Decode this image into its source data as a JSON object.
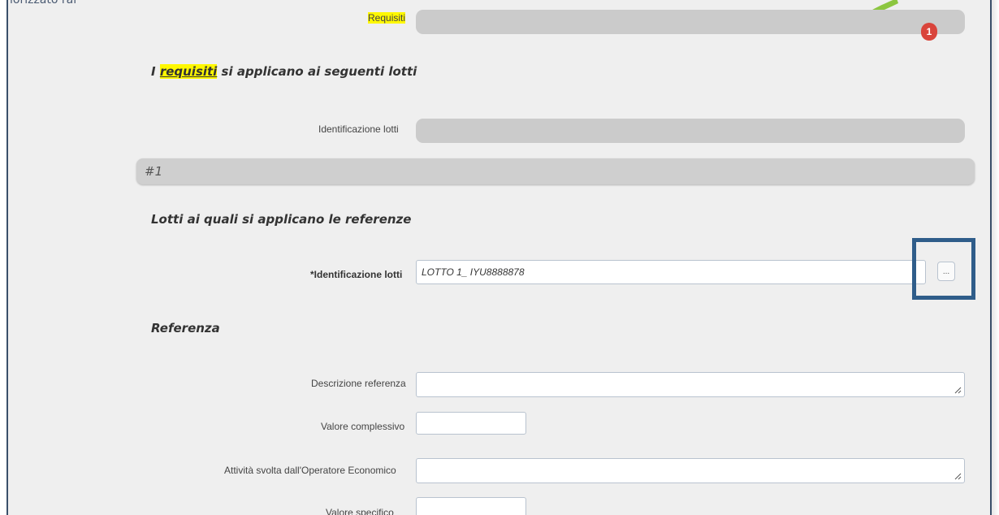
{
  "header": {
    "partial_text": "lorizzato rai",
    "requisiti_label": "Requisiti",
    "badge_count": "1"
  },
  "lotti_section": {
    "title_prefix": "I ",
    "title_highlight": "requisiti",
    "title_suffix": " si applicano ai seguenti lotti",
    "identificazione_label": "Identificazione lotti"
  },
  "group_bar": {
    "label": "#1"
  },
  "referenze_section": {
    "title": "Lotti ai quali si applicano le referenze",
    "identificazione_label": "*Identificazione lotti",
    "identificazione_value": "LOTTO 1_ IYU8888878",
    "browse_button": "..."
  },
  "referenza": {
    "title": "Referenza",
    "descrizione_label": "Descrizione referenza",
    "descrizione_value": "",
    "valore_complessivo_label": "Valore complessivo",
    "valore_complessivo_value": "",
    "attivita_label": "Attività svolta dall'Operatore Economico",
    "attivita_value": "",
    "valore_specifico_label": "Valore specifico",
    "valore_specifico_value": ""
  },
  "colors": {
    "highlight_yellow": "#fff800",
    "badge_red": "#d9443b",
    "annotation_blue": "#2f5d8a"
  }
}
